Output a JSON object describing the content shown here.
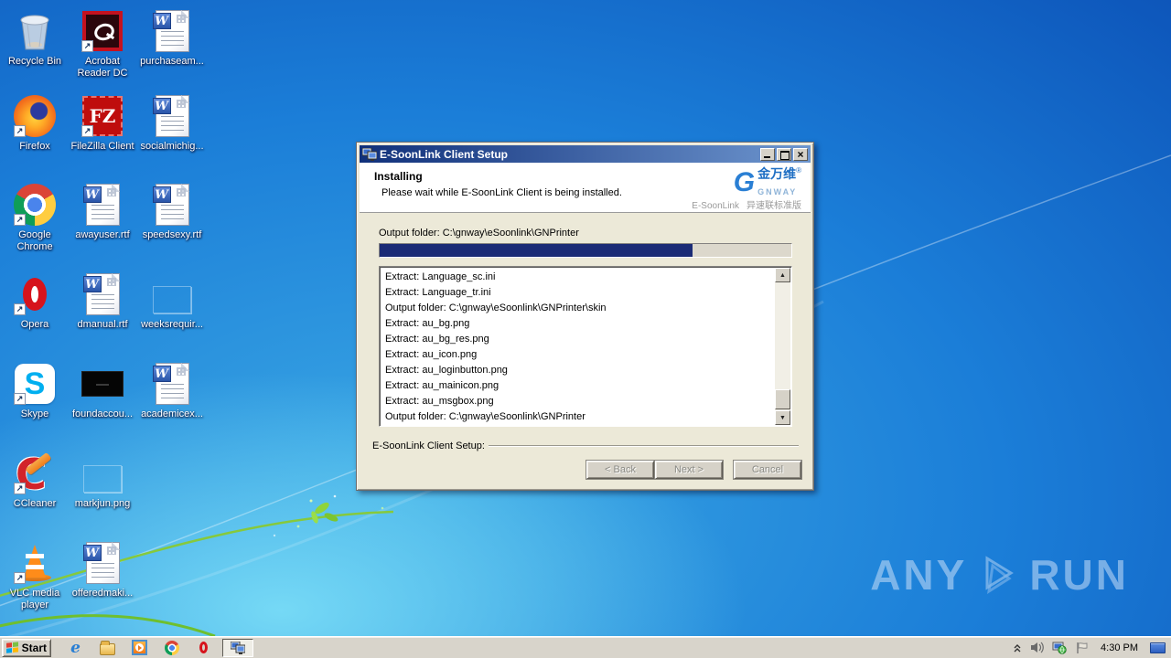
{
  "desktop": {
    "icons": [
      {
        "label": "Recycle Bin"
      },
      {
        "label": "Acrobat Reader DC"
      },
      {
        "label": "purchaseam..."
      },
      {
        "label": "Firefox"
      },
      {
        "label": "FileZilla Client"
      },
      {
        "label": "socialmichig..."
      },
      {
        "label": "Google Chrome"
      },
      {
        "label": "awayuser.rtf"
      },
      {
        "label": "speedsexy.rtf"
      },
      {
        "label": "Opera"
      },
      {
        "label": "dmanual.rtf"
      },
      {
        "label": "weeksrequir..."
      },
      {
        "label": "Skype"
      },
      {
        "label": "foundaccou..."
      },
      {
        "label": "academicex..."
      },
      {
        "label": "CCleaner"
      },
      {
        "label": "markjun.png"
      },
      {
        "label": "VLC media player"
      },
      {
        "label": "offeredmaki..."
      }
    ],
    "watermark": {
      "prefix": "ANY",
      "suffix": "RUN"
    }
  },
  "window": {
    "title": "E-SoonLink Client Setup",
    "header": {
      "title": "Installing",
      "subtitle": "Please wait while E-SoonLink Client is being installed.",
      "brand_g": "G",
      "brand_cn": "金万维",
      "brand_reg": "®",
      "brand_en": "GNWAY",
      "brand_product": "E-SoonLink",
      "brand_edition": "异速联标准版"
    },
    "output_folder": "Output folder: C:\\gnway\\eSoonlink\\GNPrinter",
    "progress_percent": 76,
    "log_lines": [
      "Extract: Language_sc.ini",
      "Extract: Language_tr.ini",
      "Output folder: C:\\gnway\\eSoonlink\\GNPrinter\\skin",
      "Extract: au_bg.png",
      "Extract: au_bg_res.png",
      "Extract: au_icon.png",
      "Extract: au_loginbutton.png",
      "Extract: au_mainicon.png",
      "Extract: au_msgbox.png",
      "Output folder: C:\\gnway\\eSoonlink\\GNPrinter"
    ],
    "groupbox_label": "E-SoonLink Client Setup:",
    "buttons": {
      "back": "< Back",
      "next": "Next >",
      "cancel": "Cancel"
    }
  },
  "taskbar": {
    "start_label": "Start",
    "clock": "4:30 PM"
  },
  "colors": {
    "titlebar_left": "#10307a",
    "titlebar_right": "#6e96cf",
    "progress_fill": "#1b2b76",
    "desktop_light": "#55c5ec",
    "desktop_dark": "#0a47a4",
    "taskbar_bg": "#d8d4cb"
  }
}
